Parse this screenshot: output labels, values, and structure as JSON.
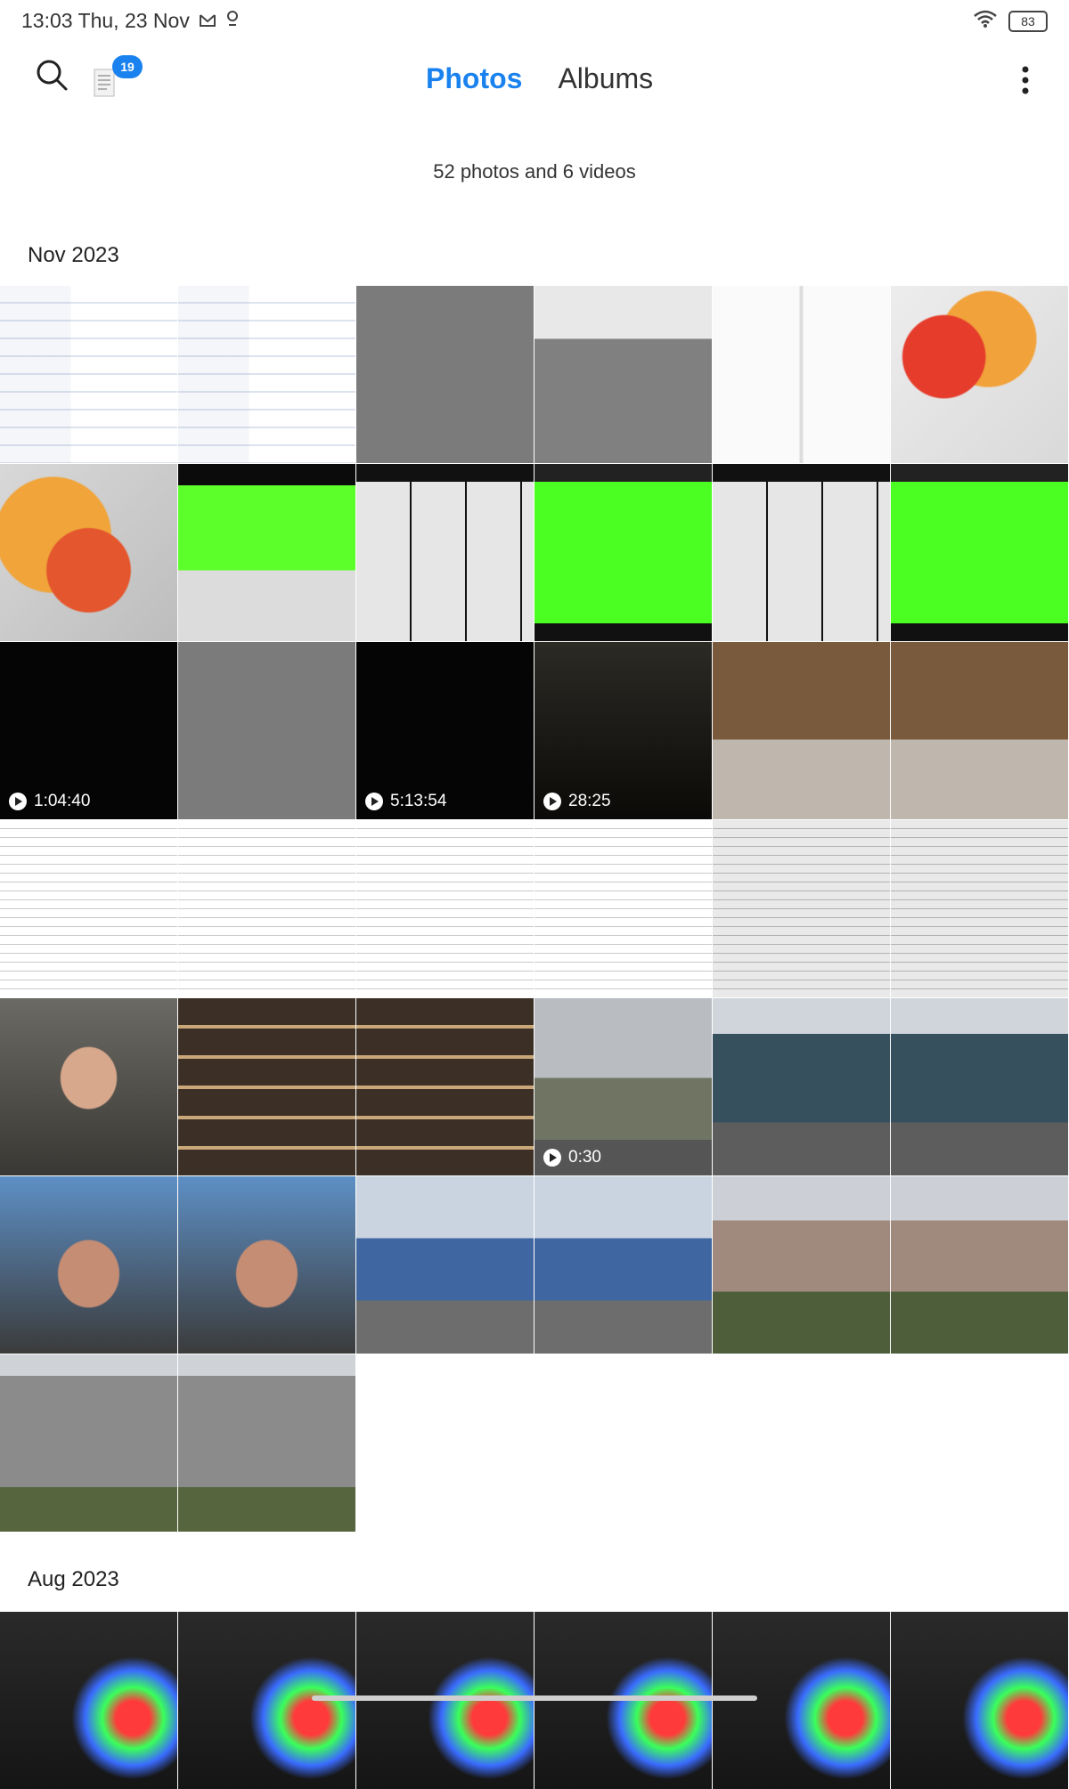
{
  "status": {
    "time_date": "13:03 Thu, 23 Nov",
    "battery": "83"
  },
  "header": {
    "notification_count": "19",
    "tabs": [
      {
        "label": "Photos"
      },
      {
        "label": "Albums"
      }
    ]
  },
  "summary": "52 photos and 6 videos",
  "accent_color": "#1a82ee",
  "sections": [
    {
      "title": "Nov 2023",
      "items": [
        {
          "name": "screenshot-file-manager",
          "duration": ""
        },
        {
          "name": "screenshot-settings",
          "duration": ""
        },
        {
          "name": "screenshot-control-center",
          "duration": ""
        },
        {
          "name": "screenshot-notifications",
          "duration": ""
        },
        {
          "name": "screenshot-news",
          "duration": ""
        },
        {
          "name": "screenshot-home-wallpaper",
          "duration": ""
        },
        {
          "name": "wallpaper",
          "duration": ""
        },
        {
          "name": "cpu-throttle-test",
          "duration": ""
        },
        {
          "name": "cpu-monitor",
          "duration": ""
        },
        {
          "name": "performance-graph",
          "duration": ""
        },
        {
          "name": "cpu-monitor-2",
          "duration": ""
        },
        {
          "name": "performance-graph-2",
          "duration": ""
        },
        {
          "name": "video-dark",
          "duration": "1:04:40"
        },
        {
          "name": "screenshot-dark-control",
          "duration": ""
        },
        {
          "name": "video-dark-2",
          "duration": "5:13:54"
        },
        {
          "name": "video-lowlight",
          "duration": "28:25"
        },
        {
          "name": "studio-room",
          "duration": ""
        },
        {
          "name": "studio-room-2",
          "duration": ""
        },
        {
          "name": "document-1",
          "duration": ""
        },
        {
          "name": "document-2",
          "duration": ""
        },
        {
          "name": "document-3",
          "duration": ""
        },
        {
          "name": "document-4",
          "duration": ""
        },
        {
          "name": "document-5",
          "duration": ""
        },
        {
          "name": "document-6",
          "duration": ""
        },
        {
          "name": "selfie-indoor",
          "duration": ""
        },
        {
          "name": "shelves",
          "duration": ""
        },
        {
          "name": "shelves-2",
          "duration": ""
        },
        {
          "name": "video-park",
          "duration": "0:30"
        },
        {
          "name": "glass-tower",
          "duration": ""
        },
        {
          "name": "glass-tower-2",
          "duration": ""
        },
        {
          "name": "selfie-outdoor",
          "duration": ""
        },
        {
          "name": "selfie-outdoor-2",
          "duration": ""
        },
        {
          "name": "castle-building",
          "duration": ""
        },
        {
          "name": "castle-building-2",
          "duration": ""
        },
        {
          "name": "hotel-building",
          "duration": ""
        },
        {
          "name": "hotel-building-2",
          "duration": ""
        },
        {
          "name": "apartment-building",
          "duration": ""
        },
        {
          "name": "apartment-building-2",
          "duration": ""
        }
      ]
    },
    {
      "title": "Aug 2023",
      "items": [
        {
          "name": "display-analysis-1",
          "duration": ""
        },
        {
          "name": "display-analysis-2",
          "duration": ""
        },
        {
          "name": "display-analysis-3",
          "duration": ""
        },
        {
          "name": "display-analysis-4",
          "duration": ""
        },
        {
          "name": "display-analysis-5",
          "duration": ""
        },
        {
          "name": "display-analysis-6",
          "duration": ""
        }
      ]
    }
  ]
}
